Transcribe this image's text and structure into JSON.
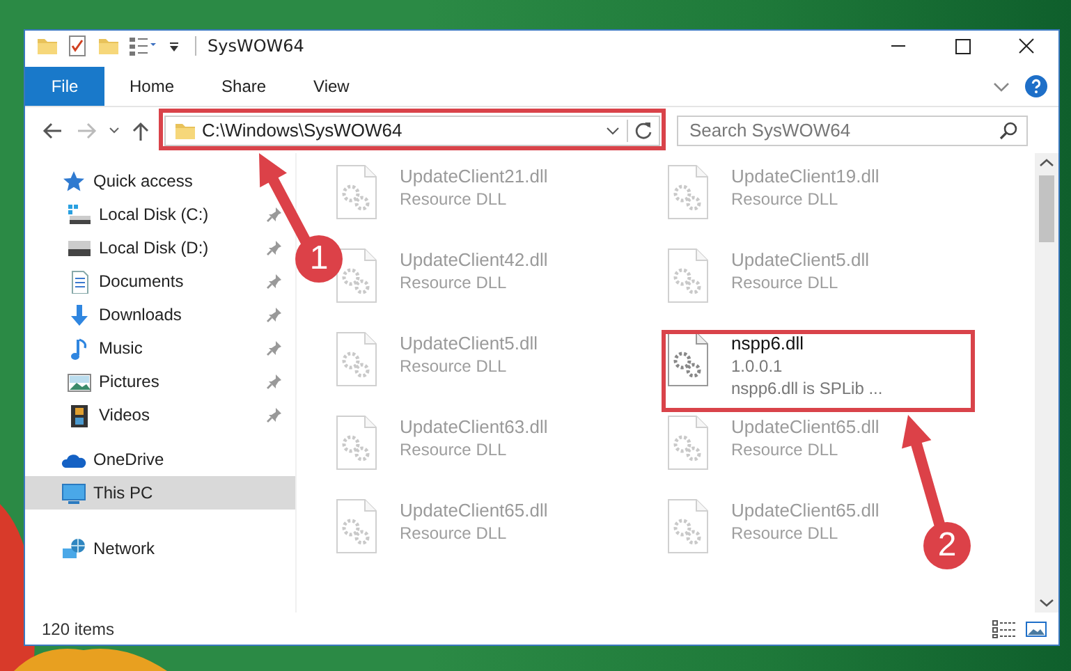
{
  "window": {
    "title": "SysWOW64"
  },
  "ribbon_tabs": [
    {
      "label": "File",
      "kind": "file",
      "selected": false
    },
    {
      "label": "Home",
      "kind": "tab",
      "selected": false
    },
    {
      "label": "Share",
      "kind": "tab",
      "selected": false
    },
    {
      "label": "View",
      "kind": "tab",
      "selected": false
    }
  ],
  "address": {
    "path": "C:\\Windows\\SysWOW64"
  },
  "search": {
    "placeholder": "Search SysWOW64"
  },
  "sidebar": {
    "items": [
      {
        "label": "Quick access",
        "selected": false,
        "children": [
          {
            "label": "Local Disk (C:)",
            "pinned": true,
            "selected": false
          },
          {
            "label": "Local Disk (D:)",
            "pinned": true,
            "selected": false
          },
          {
            "label": "Documents",
            "pinned": true,
            "selected": false
          },
          {
            "label": "Downloads",
            "pinned": true,
            "selected": false
          },
          {
            "label": "Music",
            "pinned": true,
            "selected": false
          },
          {
            "label": "Pictures",
            "pinned": true,
            "selected": false
          },
          {
            "label": "Videos",
            "pinned": true,
            "selected": false
          }
        ]
      },
      {
        "label": "OneDrive",
        "selected": false
      },
      {
        "label": "This PC",
        "selected": true
      },
      {
        "label": "Network",
        "selected": false
      }
    ]
  },
  "files": [
    {
      "name": "UpdateClient21.dll",
      "details": [
        "Resource DLL"
      ],
      "faded": true
    },
    {
      "name": "UpdateClient19.dll",
      "details": [
        "Resource DLL"
      ],
      "faded": true
    },
    {
      "name": "UpdateClient42.dll",
      "details": [
        "Resource DLL"
      ],
      "faded": true
    },
    {
      "name": "UpdateClient5.dll",
      "details": [
        "Resource DLL"
      ],
      "faded": true
    },
    {
      "name": "UpdateClient5.dll",
      "details": [
        "Resource DLL"
      ],
      "faded": true
    },
    {
      "name": "nspp6.dll",
      "details": [
        "1.0.0.1",
        "nspp6.dll is SPLib ..."
      ],
      "faded": false
    },
    {
      "name": "UpdateClient63.dll",
      "details": [
        "Resource DLL"
      ],
      "faded": true
    },
    {
      "name": "UpdateClient65.dll",
      "details": [
        "Resource DLL"
      ],
      "faded": true
    },
    {
      "name": "UpdateClient65.dll",
      "details": [
        "Resource DLL"
      ],
      "faded": true
    },
    {
      "name": "UpdateClient65.dll",
      "details": [
        "Resource DLL"
      ],
      "faded": true
    }
  ],
  "status_bar": {
    "item_count": "120 items"
  },
  "annotations": [
    {
      "number": "1"
    },
    {
      "number": "2"
    }
  ]
}
